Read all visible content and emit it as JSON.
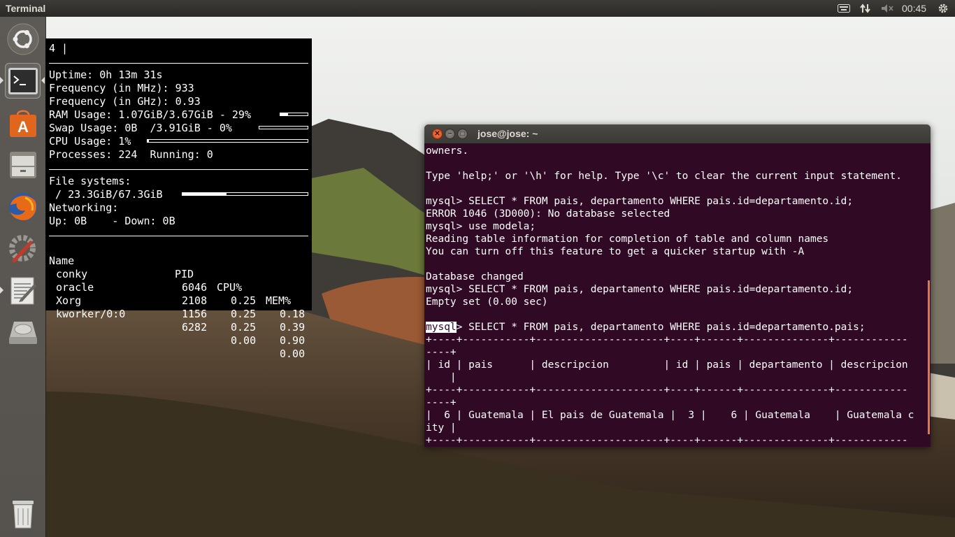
{
  "top_panel": {
    "title": "Terminal",
    "clock": "00:45",
    "indicators": [
      "keyboard-icon",
      "network-icon",
      "volume-mute-icon",
      "gear-icon"
    ]
  },
  "launcher": {
    "items": [
      {
        "name": "ubuntu-logo-icon",
        "label": "Dash"
      },
      {
        "name": "terminal-icon",
        "label": "Terminal",
        "active": true
      },
      {
        "name": "software-center-icon",
        "label": "Ubuntu Software Center"
      },
      {
        "name": "file-manager-icon",
        "label": "Files"
      },
      {
        "name": "firefox-icon",
        "label": "Firefox"
      },
      {
        "name": "system-settings-icon",
        "label": "System Settings"
      },
      {
        "name": "text-editor-icon",
        "label": "Text Editor"
      },
      {
        "name": "disk-icon",
        "label": "Disk"
      },
      {
        "name": "trash-icon",
        "label": "Trash"
      }
    ]
  },
  "conky": {
    "header": "4 |",
    "uptime": "Uptime: 0h 13m 31s",
    "freq_mhz": "Frequency (in MHz): 933",
    "freq_ghz": "Frequency (in GHz): 0.93",
    "ram": "RAM Usage: 1.07GiB/3.67GiB - 29%",
    "ram_pct": 29,
    "swap": "Swap Usage: 0B  /3.91GiB - 0%",
    "swap_pct": 0,
    "cpu": "CPU Usage: 1%",
    "cpu_pct": 1,
    "processes": "Processes: 224  Running: 0",
    "fs_label": "File systems:",
    "fs_root": " / 23.3GiB/67.3GiB",
    "fs_pct": 35,
    "net_label": "Networking:",
    "net": "Up: 0B    - Down: 0B",
    "proc_headers": [
      "Name",
      "PID",
      "CPU%",
      "MEM%"
    ],
    "procs": [
      {
        "name": "conky",
        "pid": "6046",
        "cpu": "0.25",
        "mem": "0.18"
      },
      {
        "name": "oracle",
        "pid": "2108",
        "cpu": "0.25",
        "mem": "0.39"
      },
      {
        "name": "Xorg",
        "pid": "1156",
        "cpu": "0.25",
        "mem": "0.90"
      },
      {
        "name": "kworker/0:0",
        "pid": "6282",
        "cpu": "0.00",
        "mem": "0.00"
      }
    ]
  },
  "terminal": {
    "title": "jose@jose: ~",
    "lines": [
      "owners.",
      "",
      "Type 'help;' or '\\h' for help. Type '\\c' to clear the current input statement.",
      "",
      "mysql> SELECT * FROM pais, departamento WHERE pais.id=departamento.id;",
      "ERROR 1046 (3D000): No database selected",
      "mysql> use modela;",
      "Reading table information for completion of table and column names",
      "You can turn off this feature to get a quicker startup with -A",
      "",
      "Database changed",
      "mysql> SELECT * FROM pais, departamento WHERE pais.id=departamento.id;",
      "Empty set (0.00 sec)",
      "",
      "",
      "+----+-----------+---------------------+----+------+--------------+------------",
      "----+",
      "| id | pais      | descripcion         | id | pais | departamento | descripcion",
      "    |",
      "+----+-----------+---------------------+----+------+--------------+------------",
      "----+",
      "|  6 | Guatemala | El pais de Guatemala |  3 |    6 | Guatemala    | Guatemala c",
      "ity |",
      "+----+-----------+---------------------+----+------+--------------+------------"
    ],
    "selected_prompt": "mysql",
    "selected_rest": "> SELECT * FROM pais, departamento WHERE pais.id=departamento.pais;"
  }
}
